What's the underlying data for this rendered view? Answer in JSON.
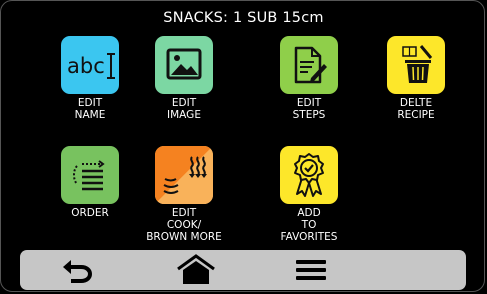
{
  "header": {
    "title": "SNACKS: 1 SUB 15cm"
  },
  "tiles": [
    {
      "name": "edit-name",
      "label": "EDIT\nNAME",
      "color": "#3bc6f0",
      "icon_text": "abc"
    },
    {
      "name": "edit-image",
      "label": "EDIT\nIMAGE",
      "color": "#7cd7a3"
    },
    {
      "name": "edit-steps",
      "label": "EDIT\nSTEPS",
      "color": "#8fcf4a"
    },
    {
      "name": "delete-recipe",
      "label": "DELTE\nRECIPE",
      "color": "#fde72a"
    },
    {
      "name": "order",
      "label": "ORDER",
      "color": "#78c25f"
    },
    {
      "name": "edit-cook-brown-more",
      "label": "EDIT\nCOOK/\nBROWN MORE",
      "color_a": "#f58220",
      "color_b": "#f9b25a"
    },
    {
      "name": "add-to-favorites",
      "label": "ADD\nTO\nFAVORITES",
      "color": "#fde72a"
    }
  ],
  "navbar": {
    "color": "#c6c6c6",
    "buttons": [
      {
        "name": "back-button",
        "icon": "back-arrow-icon"
      },
      {
        "name": "home-button",
        "icon": "home-icon"
      },
      {
        "name": "menu-button",
        "icon": "menu-icon"
      }
    ]
  }
}
